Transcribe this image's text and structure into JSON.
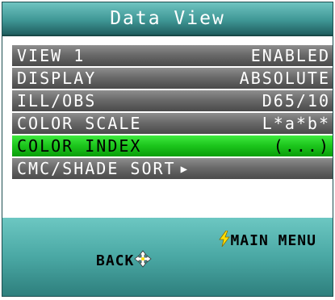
{
  "header": {
    "title": "Data View"
  },
  "menu": {
    "rows": [
      {
        "label": "VIEW 1",
        "value": "ENABLED",
        "selected": false
      },
      {
        "label": "DISPLAY",
        "value": "ABSOLUTE",
        "selected": false
      },
      {
        "label": "ILL/OBS",
        "value": "D65/10",
        "selected": false
      },
      {
        "label": "COLOR SCALE",
        "value": "L*a*b*",
        "selected": false
      },
      {
        "label": "COLOR INDEX",
        "value": "(...)",
        "selected": true
      },
      {
        "label": "CMC/SHADE SORT",
        "value": "",
        "selected": false,
        "submenu_icon": "right-triangle-icon"
      }
    ]
  },
  "softkeys": {
    "main_menu": {
      "label": "MAIN MENU",
      "icon": "lightning-icon"
    },
    "back": {
      "label": "BACK",
      "icon": "four-way-arrow-icon"
    }
  },
  "colors": {
    "title_bar": "#3f9795",
    "row_normal": "#6a6a6a",
    "row_selected": "#1bc41b",
    "bottom_bar": "#4aa8a4",
    "lightning": "#ffe000"
  }
}
